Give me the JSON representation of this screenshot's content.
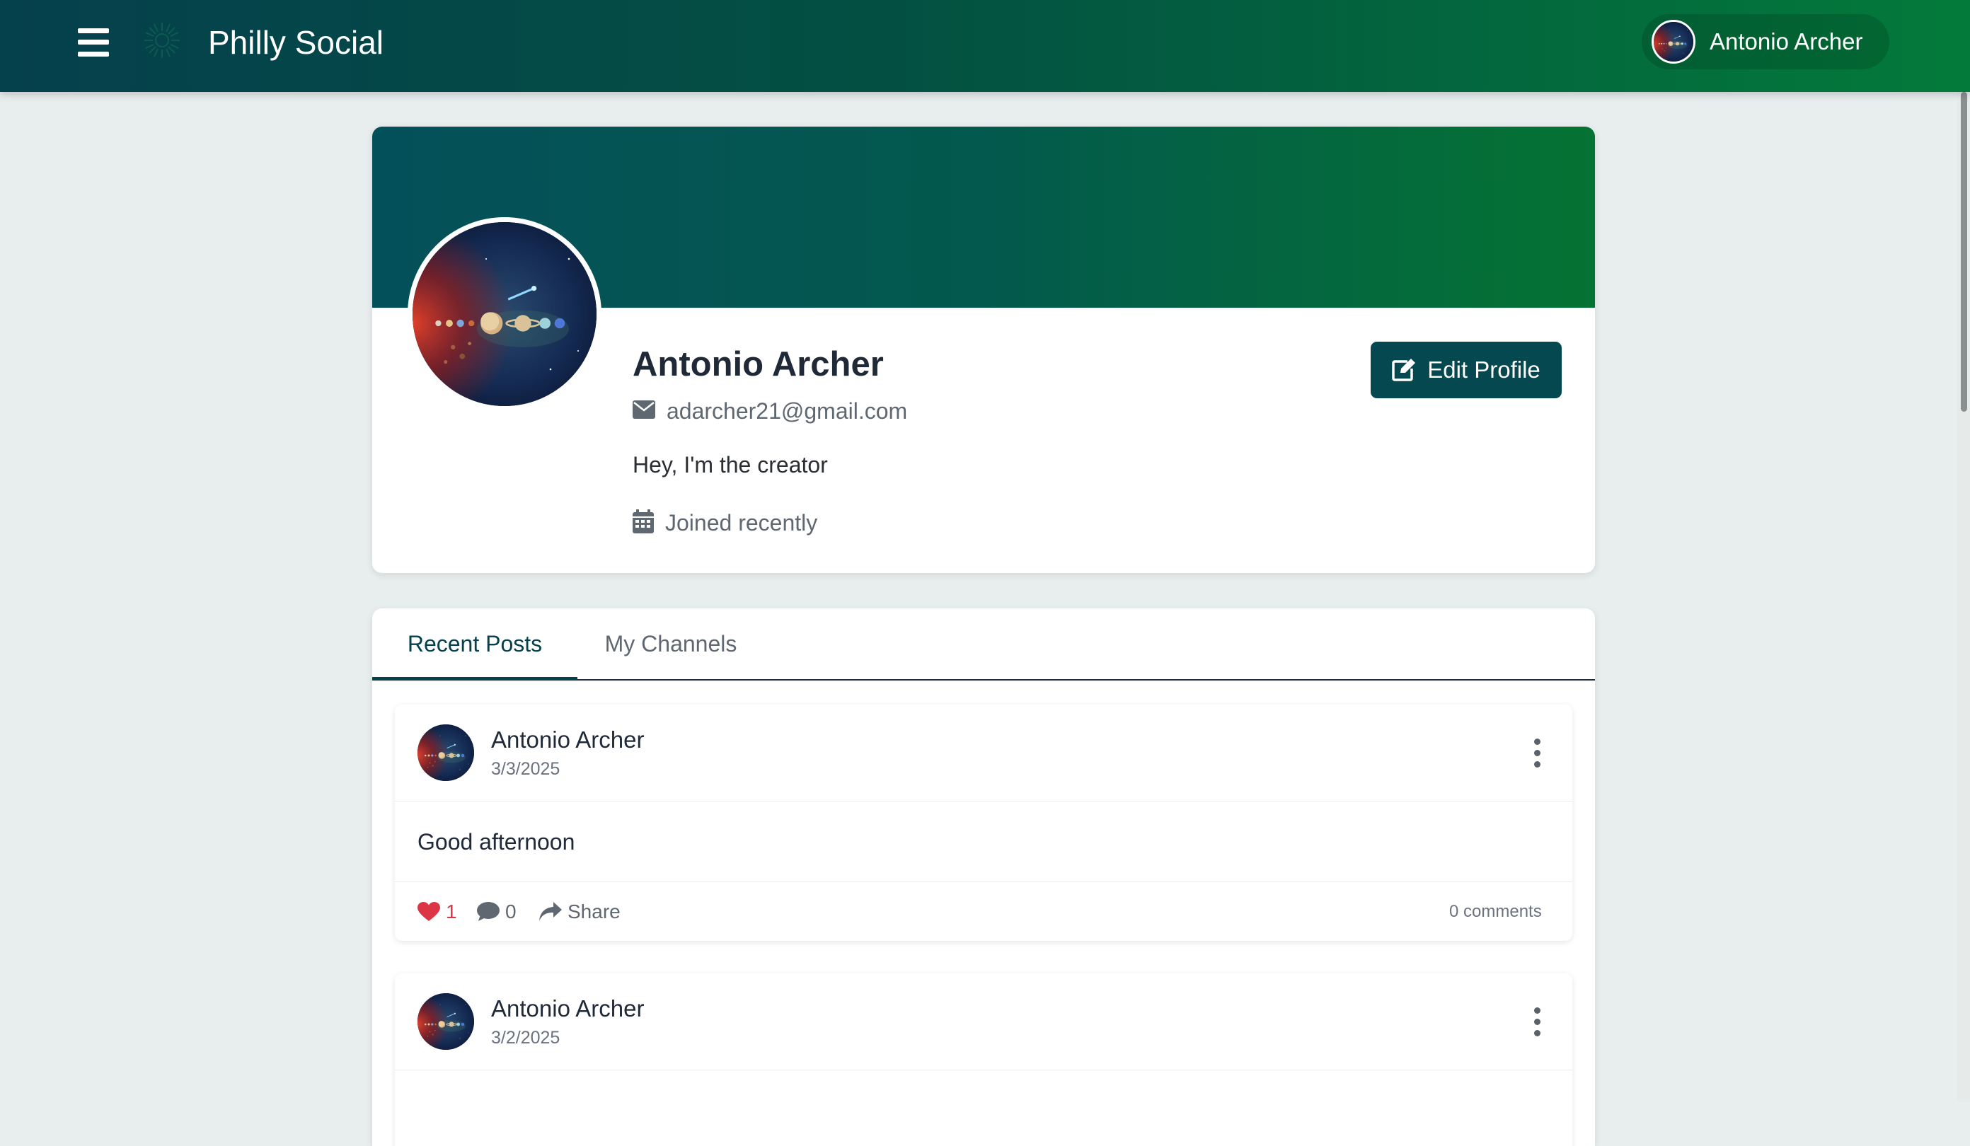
{
  "app": {
    "title": "Philly Social"
  },
  "header": {
    "user_name": "Antonio Archer"
  },
  "profile": {
    "name": "Antonio Archer",
    "email": "adarcher21@gmail.com",
    "bio": "Hey, I'm the creator",
    "joined": "Joined recently",
    "edit_label": "Edit Profile"
  },
  "tabs": [
    {
      "label": "Recent Posts",
      "active": true
    },
    {
      "label": "My Channels",
      "active": false
    }
  ],
  "posts": [
    {
      "author": "Antonio Archer",
      "date": "3/3/2025",
      "body": "Good afternoon",
      "likes": "1",
      "comments": "0",
      "share_label": "Share",
      "comments_label": "0 comments",
      "liked": true
    },
    {
      "author": "Antonio Archer",
      "date": "3/2/2025"
    }
  ],
  "icons": {
    "menu": "hamburger-icon",
    "logo": "logo-icon",
    "email": "envelope-icon",
    "joined": "calendar-icon",
    "edit": "edit-icon",
    "like": "heart-icon",
    "comment": "comment-icon",
    "share": "share-icon",
    "more": "kebab-menu-icon"
  },
  "colors": {
    "nav_start": "#05404d",
    "nav_end": "#037a3a",
    "accent": "#054850",
    "like": "#dc3545",
    "background": "#e8eeee"
  }
}
